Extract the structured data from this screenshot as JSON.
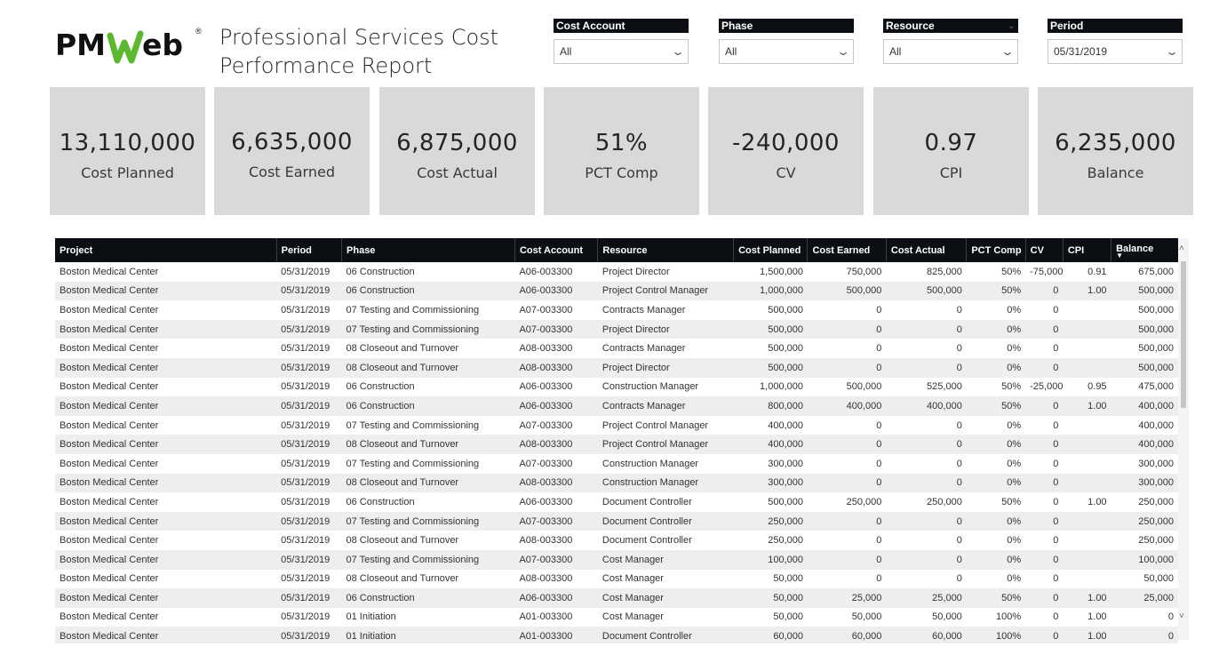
{
  "header": {
    "logo_text": "PMWeb",
    "logo_reg": "®",
    "title": "Professional Services Cost Performance Report"
  },
  "slicers": [
    {
      "label": "Cost Account",
      "value": "All"
    },
    {
      "label": "Phase",
      "value": "All"
    },
    {
      "label": "Resource",
      "value": "All"
    },
    {
      "label": "Period",
      "value": "05/31/2019"
    }
  ],
  "kpis": [
    {
      "value": "13,110,000",
      "label": "Cost Planned"
    },
    {
      "value": "6,635,000",
      "label": "Cost Earned"
    },
    {
      "value": "6,875,000",
      "label": "Cost Actual"
    },
    {
      "value": "51%",
      "label": "PCT Comp"
    },
    {
      "value": "-240,000",
      "label": "CV"
    },
    {
      "value": "0.97",
      "label": "CPI"
    },
    {
      "value": "6,235,000",
      "label": "Balance"
    }
  ],
  "table": {
    "columns": [
      "Project",
      "Period",
      "Phase",
      "Cost Account",
      "Resource",
      "Cost Planned",
      "Cost Earned",
      "Cost Actual",
      "PCT Comp",
      "CV",
      "CPI",
      "Balance"
    ],
    "sorted_column": "Balance",
    "rows": [
      [
        "Boston Medical Center",
        "05/31/2019",
        "06 Construction",
        "A06-003300",
        "Project Director",
        "1,500,000",
        "750,000",
        "825,000",
        "50%",
        "-75,000",
        "0.91",
        "675,000"
      ],
      [
        "Boston Medical Center",
        "05/31/2019",
        "06 Construction",
        "A06-003300",
        "Project Control Manager",
        "1,000,000",
        "500,000",
        "500,000",
        "50%",
        "0",
        "1.00",
        "500,000"
      ],
      [
        "Boston Medical Center",
        "05/31/2019",
        "07 Testing and Commissioning",
        "A07-003300",
        "Contracts Manager",
        "500,000",
        "0",
        "0",
        "0%",
        "0",
        "",
        "500,000"
      ],
      [
        "Boston Medical Center",
        "05/31/2019",
        "07 Testing and Commissioning",
        "A07-003300",
        "Project Director",
        "500,000",
        "0",
        "0",
        "0%",
        "0",
        "",
        "500,000"
      ],
      [
        "Boston Medical Center",
        "05/31/2019",
        "08 Closeout and Turnover",
        "A08-003300",
        "Contracts Manager",
        "500,000",
        "0",
        "0",
        "0%",
        "0",
        "",
        "500,000"
      ],
      [
        "Boston Medical Center",
        "05/31/2019",
        "08 Closeout and Turnover",
        "A08-003300",
        "Project Director",
        "500,000",
        "0",
        "0",
        "0%",
        "0",
        "",
        "500,000"
      ],
      [
        "Boston Medical Center",
        "05/31/2019",
        "06 Construction",
        "A06-003300",
        "Construction Manager",
        "1,000,000",
        "500,000",
        "525,000",
        "50%",
        "-25,000",
        "0.95",
        "475,000"
      ],
      [
        "Boston Medical Center",
        "05/31/2019",
        "06 Construction",
        "A06-003300",
        "Contracts Manager",
        "800,000",
        "400,000",
        "400,000",
        "50%",
        "0",
        "1.00",
        "400,000"
      ],
      [
        "Boston Medical Center",
        "05/31/2019",
        "07 Testing and Commissioning",
        "A07-003300",
        "Project Control Manager",
        "400,000",
        "0",
        "0",
        "0%",
        "0",
        "",
        "400,000"
      ],
      [
        "Boston Medical Center",
        "05/31/2019",
        "08 Closeout and Turnover",
        "A08-003300",
        "Project Control Manager",
        "400,000",
        "0",
        "0",
        "0%",
        "0",
        "",
        "400,000"
      ],
      [
        "Boston Medical Center",
        "05/31/2019",
        "07 Testing and Commissioning",
        "A07-003300",
        "Construction Manager",
        "300,000",
        "0",
        "0",
        "0%",
        "0",
        "",
        "300,000"
      ],
      [
        "Boston Medical Center",
        "05/31/2019",
        "08 Closeout and Turnover",
        "A08-003300",
        "Construction Manager",
        "300,000",
        "0",
        "0",
        "0%",
        "0",
        "",
        "300,000"
      ],
      [
        "Boston Medical Center",
        "05/31/2019",
        "06 Construction",
        "A06-003300",
        "Document Controller",
        "500,000",
        "250,000",
        "250,000",
        "50%",
        "0",
        "1.00",
        "250,000"
      ],
      [
        "Boston Medical Center",
        "05/31/2019",
        "07 Testing and Commissioning",
        "A07-003300",
        "Document Controller",
        "250,000",
        "0",
        "0",
        "0%",
        "0",
        "",
        "250,000"
      ],
      [
        "Boston Medical Center",
        "05/31/2019",
        "08 Closeout and Turnover",
        "A08-003300",
        "Document Controller",
        "250,000",
        "0",
        "0",
        "0%",
        "0",
        "",
        "250,000"
      ],
      [
        "Boston Medical Center",
        "05/31/2019",
        "07 Testing and Commissioning",
        "A07-003300",
        "Cost Manager",
        "100,000",
        "0",
        "0",
        "0%",
        "0",
        "",
        "100,000"
      ],
      [
        "Boston Medical Center",
        "05/31/2019",
        "08 Closeout and Turnover",
        "A08-003300",
        "Cost Manager",
        "50,000",
        "0",
        "0",
        "0%",
        "0",
        "",
        "50,000"
      ],
      [
        "Boston Medical Center",
        "05/31/2019",
        "06 Construction",
        "A06-003300",
        "Cost Manager",
        "50,000",
        "25,000",
        "25,000",
        "50%",
        "0",
        "1.00",
        "25,000"
      ],
      [
        "Boston Medical Center",
        "05/31/2019",
        "01 Initiation",
        "A01-003300",
        "Cost Manager",
        "50,000",
        "50,000",
        "50,000",
        "100%",
        "0",
        "1.00",
        "0"
      ],
      [
        "Boston Medical Center",
        "05/31/2019",
        "01 Initiation",
        "A01-003300",
        "Document Controller",
        "60,000",
        "60,000",
        "60,000",
        "100%",
        "0",
        "1.00",
        "0"
      ]
    ]
  }
}
